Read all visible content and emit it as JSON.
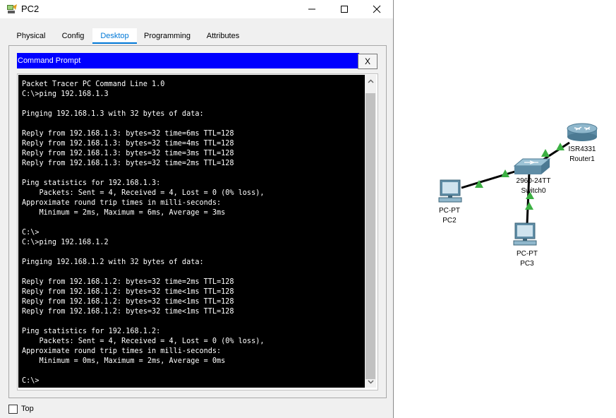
{
  "window": {
    "title": "PC2",
    "minimize_glyph": "—",
    "maximize_glyph": "☐",
    "close_glyph": "✕"
  },
  "tabs": [
    {
      "label": "Physical",
      "active": false
    },
    {
      "label": "Config",
      "active": false
    },
    {
      "label": "Desktop",
      "active": true
    },
    {
      "label": "Programming",
      "active": false
    },
    {
      "label": "Attributes",
      "active": false
    }
  ],
  "command_prompt": {
    "title": "Command Prompt",
    "close_label": "X",
    "output": "Packet Tracer PC Command Line 1.0\nC:\\>ping 192.168.1.3\n\nPinging 192.168.1.3 with 32 bytes of data:\n\nReply from 192.168.1.3: bytes=32 time=6ms TTL=128\nReply from 192.168.1.3: bytes=32 time=4ms TTL=128\nReply from 192.168.1.3: bytes=32 time=3ms TTL=128\nReply from 192.168.1.3: bytes=32 time=2ms TTL=128\n\nPing statistics for 192.168.1.3:\n    Packets: Sent = 4, Received = 4, Lost = 0 (0% loss),\nApproximate round trip times in milli-seconds:\n    Minimum = 2ms, Maximum = 6ms, Average = 3ms\n\nC:\\>\nC:\\>ping 192.168.1.2\n\nPinging 192.168.1.2 with 32 bytes of data:\n\nReply from 192.168.1.2: bytes=32 time=2ms TTL=128\nReply from 192.168.1.2: bytes=32 time<1ms TTL=128\nReply from 192.168.1.2: bytes=32 time<1ms TTL=128\nReply from 192.168.1.2: bytes=32 time<1ms TTL=128\n\nPing statistics for 192.168.1.2:\n    Packets: Sent = 4, Received = 4, Lost = 0 (0% loss),\nApproximate round trip times in milli-seconds:\n    Minimum = 0ms, Maximum = 2ms, Average = 0ms\n\nC:\\>"
  },
  "top_checkbox": {
    "label": "Top",
    "checked": false
  },
  "topology": {
    "link_color": "#000000",
    "port_up_color": "#3cb043",
    "devices": {
      "router": {
        "model": "ISR4331",
        "name": "Router1",
        "icon": "router-icon"
      },
      "switch": {
        "model": "2960-24TT",
        "name": "Switch0",
        "icon": "switch-icon"
      },
      "pc2": {
        "model": "PC-PT",
        "name": "PC2",
        "icon": "pc-icon"
      },
      "pc3": {
        "model": "PC-PT",
        "name": "PC3",
        "icon": "pc-icon"
      }
    }
  },
  "colors": {
    "accent_tab": "#0078d7",
    "prompt_titlebar": "#0000ff",
    "console_bg": "#000000",
    "console_fg": "#ffffff"
  }
}
